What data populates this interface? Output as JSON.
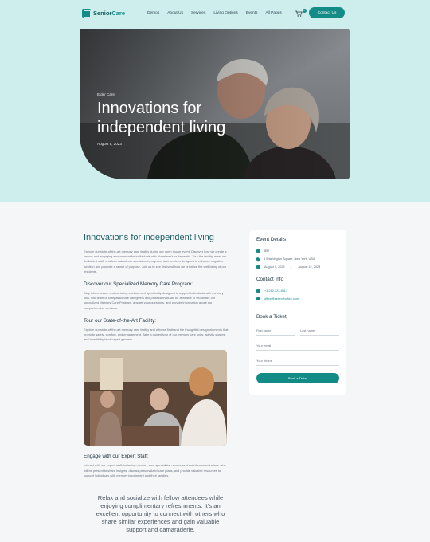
{
  "nav": {
    "logo": "SeniorCare",
    "logo_part1": "Senior",
    "logo_part2": "Care",
    "menu": [
      "Demos",
      "About Us",
      "Services",
      "Living Options",
      "Events",
      "All Pages"
    ],
    "cart_count": "0",
    "contact_label": "Contact Us"
  },
  "hero": {
    "category": "Elder Care",
    "title": "Innovations for independent living",
    "date": "August 9, 2023"
  },
  "article": {
    "title": "Innovations for independent living",
    "intro": "Explore our state-of-the-art memory care facility during our open house event. Discover how we create a secure and engaging environment for individuals with Alzheimer's or dementia. Tour the facility, meet our dedicated staff, and learn about our specialized programs and services designed to enhance cognitive function and promote a sense of purpose. Join us to see firsthand how we prioritize the well-being of our residents.",
    "section1_title": "Discover our Specialized Memory Care Program:",
    "section1_text": "Step into a secure and nurturing environment specifically designed to support individuals with memory loss. Our team of compassionate caregivers and professionals will be available to showcase our specialized Memory Care Program, answer your questions, and provide information about our comprehensive services.",
    "section2_title": "Tour our State-of-the-Art Facility:",
    "section2_text": "Explore our state-of-the-art memory care facility and witness firsthand the thoughtful design elements that promote safety, comfort, and engagement. Take a guided tour of our memory care units, activity spaces, and beautifully landscaped gardens.",
    "section3_title": "Engage with our Expert Staff:",
    "section3_text": "Interact with our expert staff, including memory care specialists, nurses, and activities coordinators, who will be present to share insights, discuss personalized care plans, and provide valuable resources to support individuals with memory impairment and their families.",
    "quote": "Relax and socialize with fellow attendees while enjoying complimentary refreshments. It's an excellent opportunity to connect with others who share similar experiences and gain valuable support and camaraderie."
  },
  "sidebar": {
    "event_details_title": "Event Details",
    "price": "$57",
    "address": "5 Washington Square, New York, USA",
    "date_start": "August 9, 2023",
    "date_end": "August 12, 2023",
    "contact_title": "Contact Info",
    "phone": "+1 212-323-8417",
    "email": "office@seller@office.com",
    "ticket_title": "Book a Ticket",
    "first_name": "First name",
    "last_name": "Last name",
    "email_placeholder": "Your email",
    "phone_placeholder": "Your phone",
    "button": "Book a Ticket"
  },
  "colors": {
    "accent": "#138b87",
    "band": "#cdeeec",
    "page": "#f5f6f8"
  }
}
